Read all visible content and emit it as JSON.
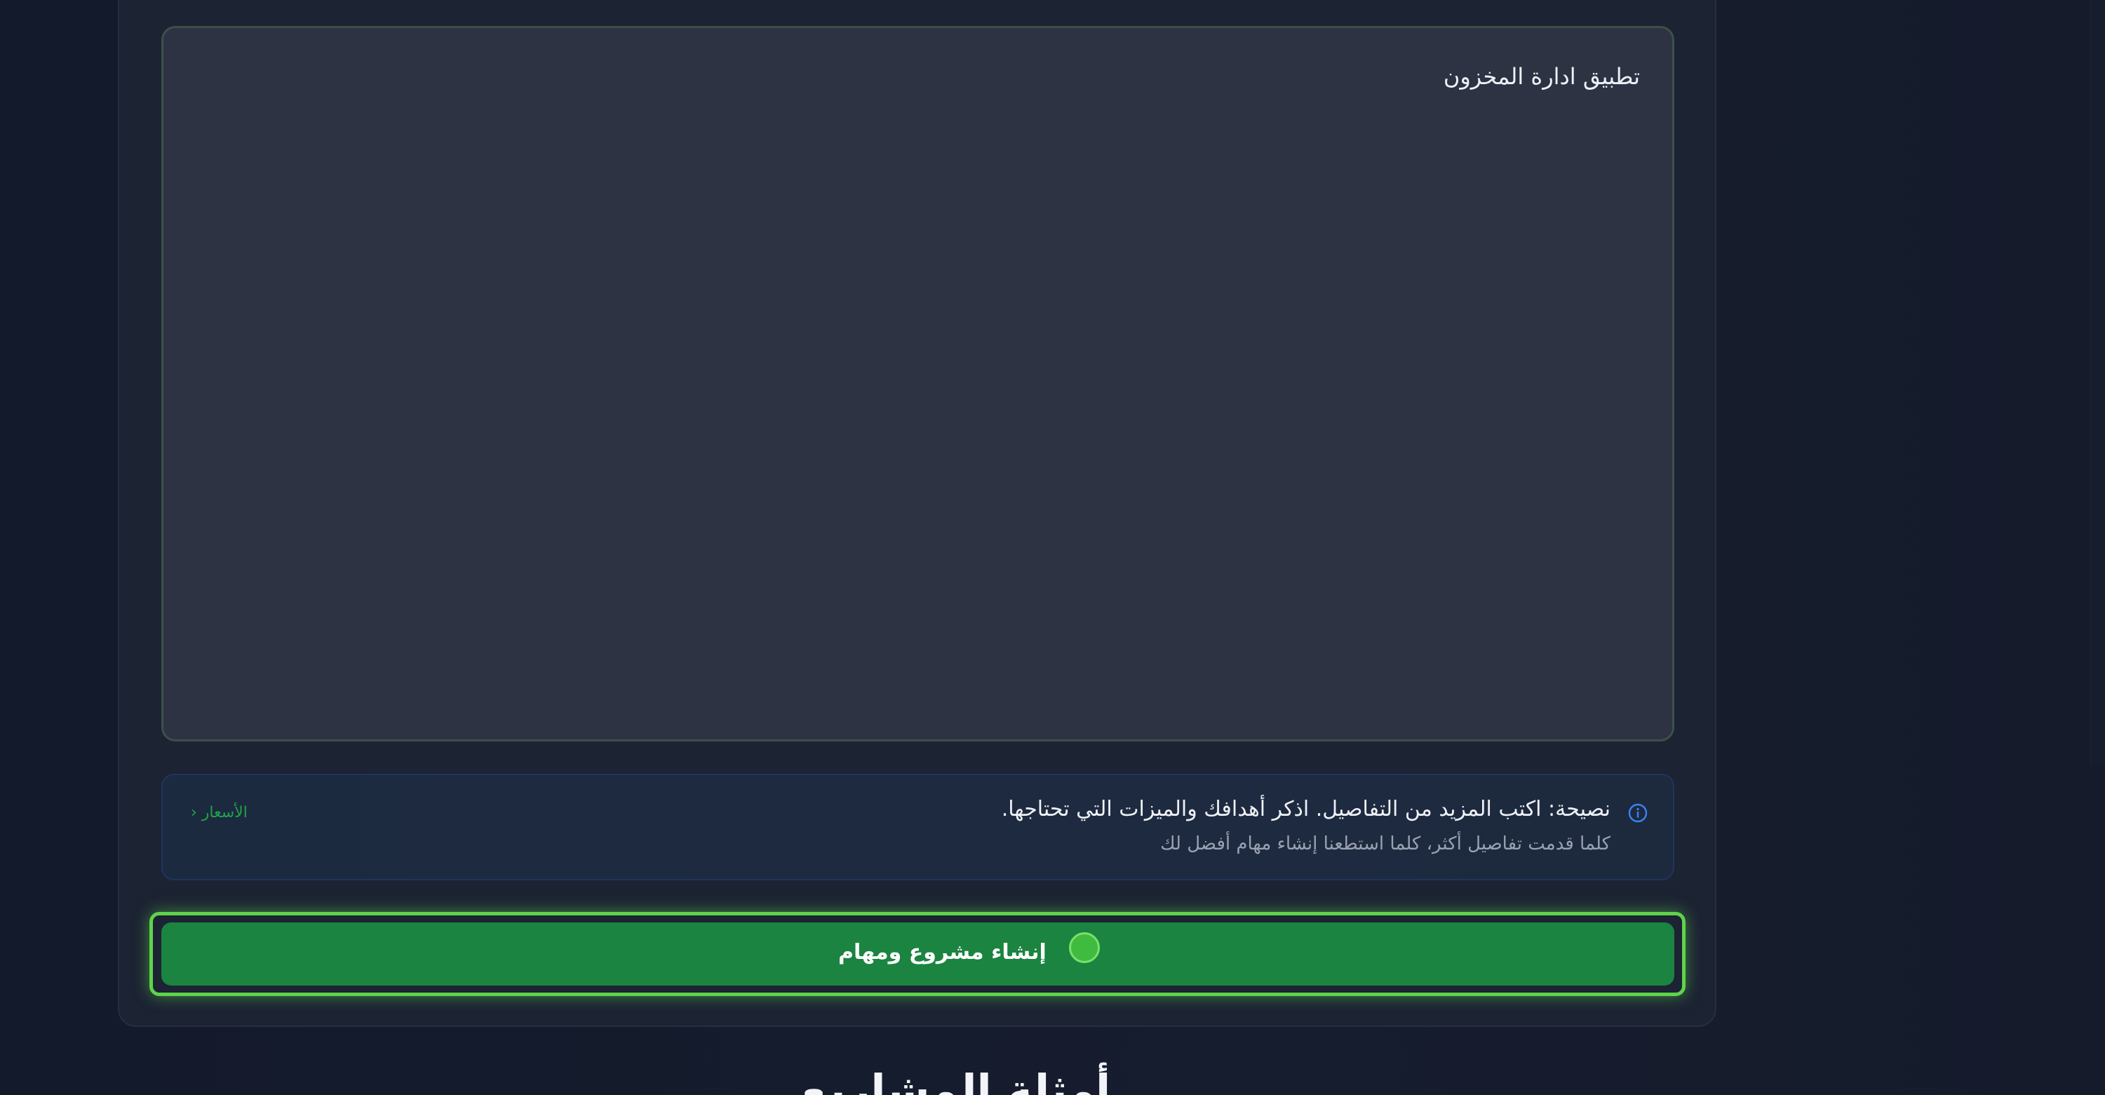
{
  "form": {
    "description_value": "تطبيق ادارة المخزون"
  },
  "tip": {
    "icon": "info-icon",
    "title": "نصيحة: اكتب المزيد من التفاصيل. اذكر أهدافك والميزات التي تحتاجها.",
    "subtitle": "كلما قدمت تفاصيل أكثر، كلما استطعنا إنشاء مهام أفضل لك",
    "pricing_link": "الأسعار ‹"
  },
  "actions": {
    "create_label": "إنشاء مشروع ومهام"
  },
  "examples": {
    "heading": "أمثلة المشاريع"
  },
  "colors": {
    "accent": "#1a8440",
    "focus_ring": "#5fd34a",
    "info_blue": "#3b82f6"
  }
}
